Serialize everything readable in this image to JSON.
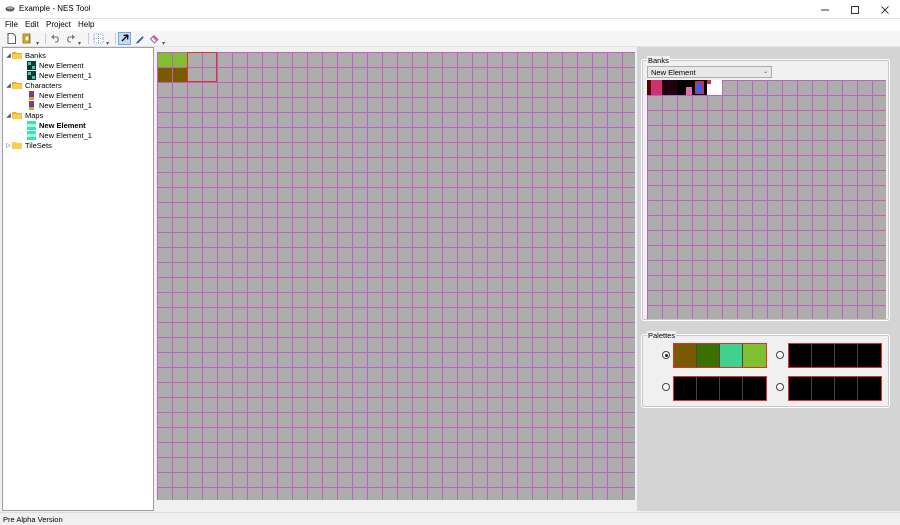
{
  "window": {
    "title": "Example - NES Tool",
    "icon": "nes-tool-icon"
  },
  "menu": {
    "file": "File",
    "edit": "Edit",
    "project": "Project",
    "help": "Help"
  },
  "toolbar": {
    "icons": [
      "new-file-icon",
      "open-folder-icon",
      "undo-icon",
      "redo-icon",
      "grid-icon",
      "select-arrow-icon",
      "pencil-icon",
      "eraser-icon"
    ],
    "active": "select-arrow-icon"
  },
  "tree": {
    "banks": {
      "label": "Banks",
      "items": [
        "New Element",
        "New Element_1"
      ]
    },
    "characters": {
      "label": "Characters",
      "items": [
        "New Element",
        "New Element_1"
      ]
    },
    "maps": {
      "label": "Maps",
      "items": [
        "New Element",
        "New Element_1"
      ],
      "selected": "New Element"
    },
    "tilesets": {
      "label": "TileSets"
    }
  },
  "banks_panel": {
    "title": "Banks",
    "selected": "New Element"
  },
  "palettes_panel": {
    "title": "Palettes",
    "selected_index": 0,
    "palettes": [
      [
        "#7a5a00",
        "#3a7000",
        "#40d090",
        "#80c030"
      ],
      [
        "#000000",
        "#000000",
        "#000000",
        "#000000"
      ],
      [
        "#000000",
        "#000000",
        "#000000",
        "#000000"
      ],
      [
        "#000000",
        "#000000",
        "#000000",
        "#000000"
      ]
    ]
  },
  "colors": {
    "grid_line": "#c060c0",
    "canvas_bg": "#adadad",
    "selection": "#e03030"
  },
  "status": {
    "text": "Pre Alpha Version"
  }
}
